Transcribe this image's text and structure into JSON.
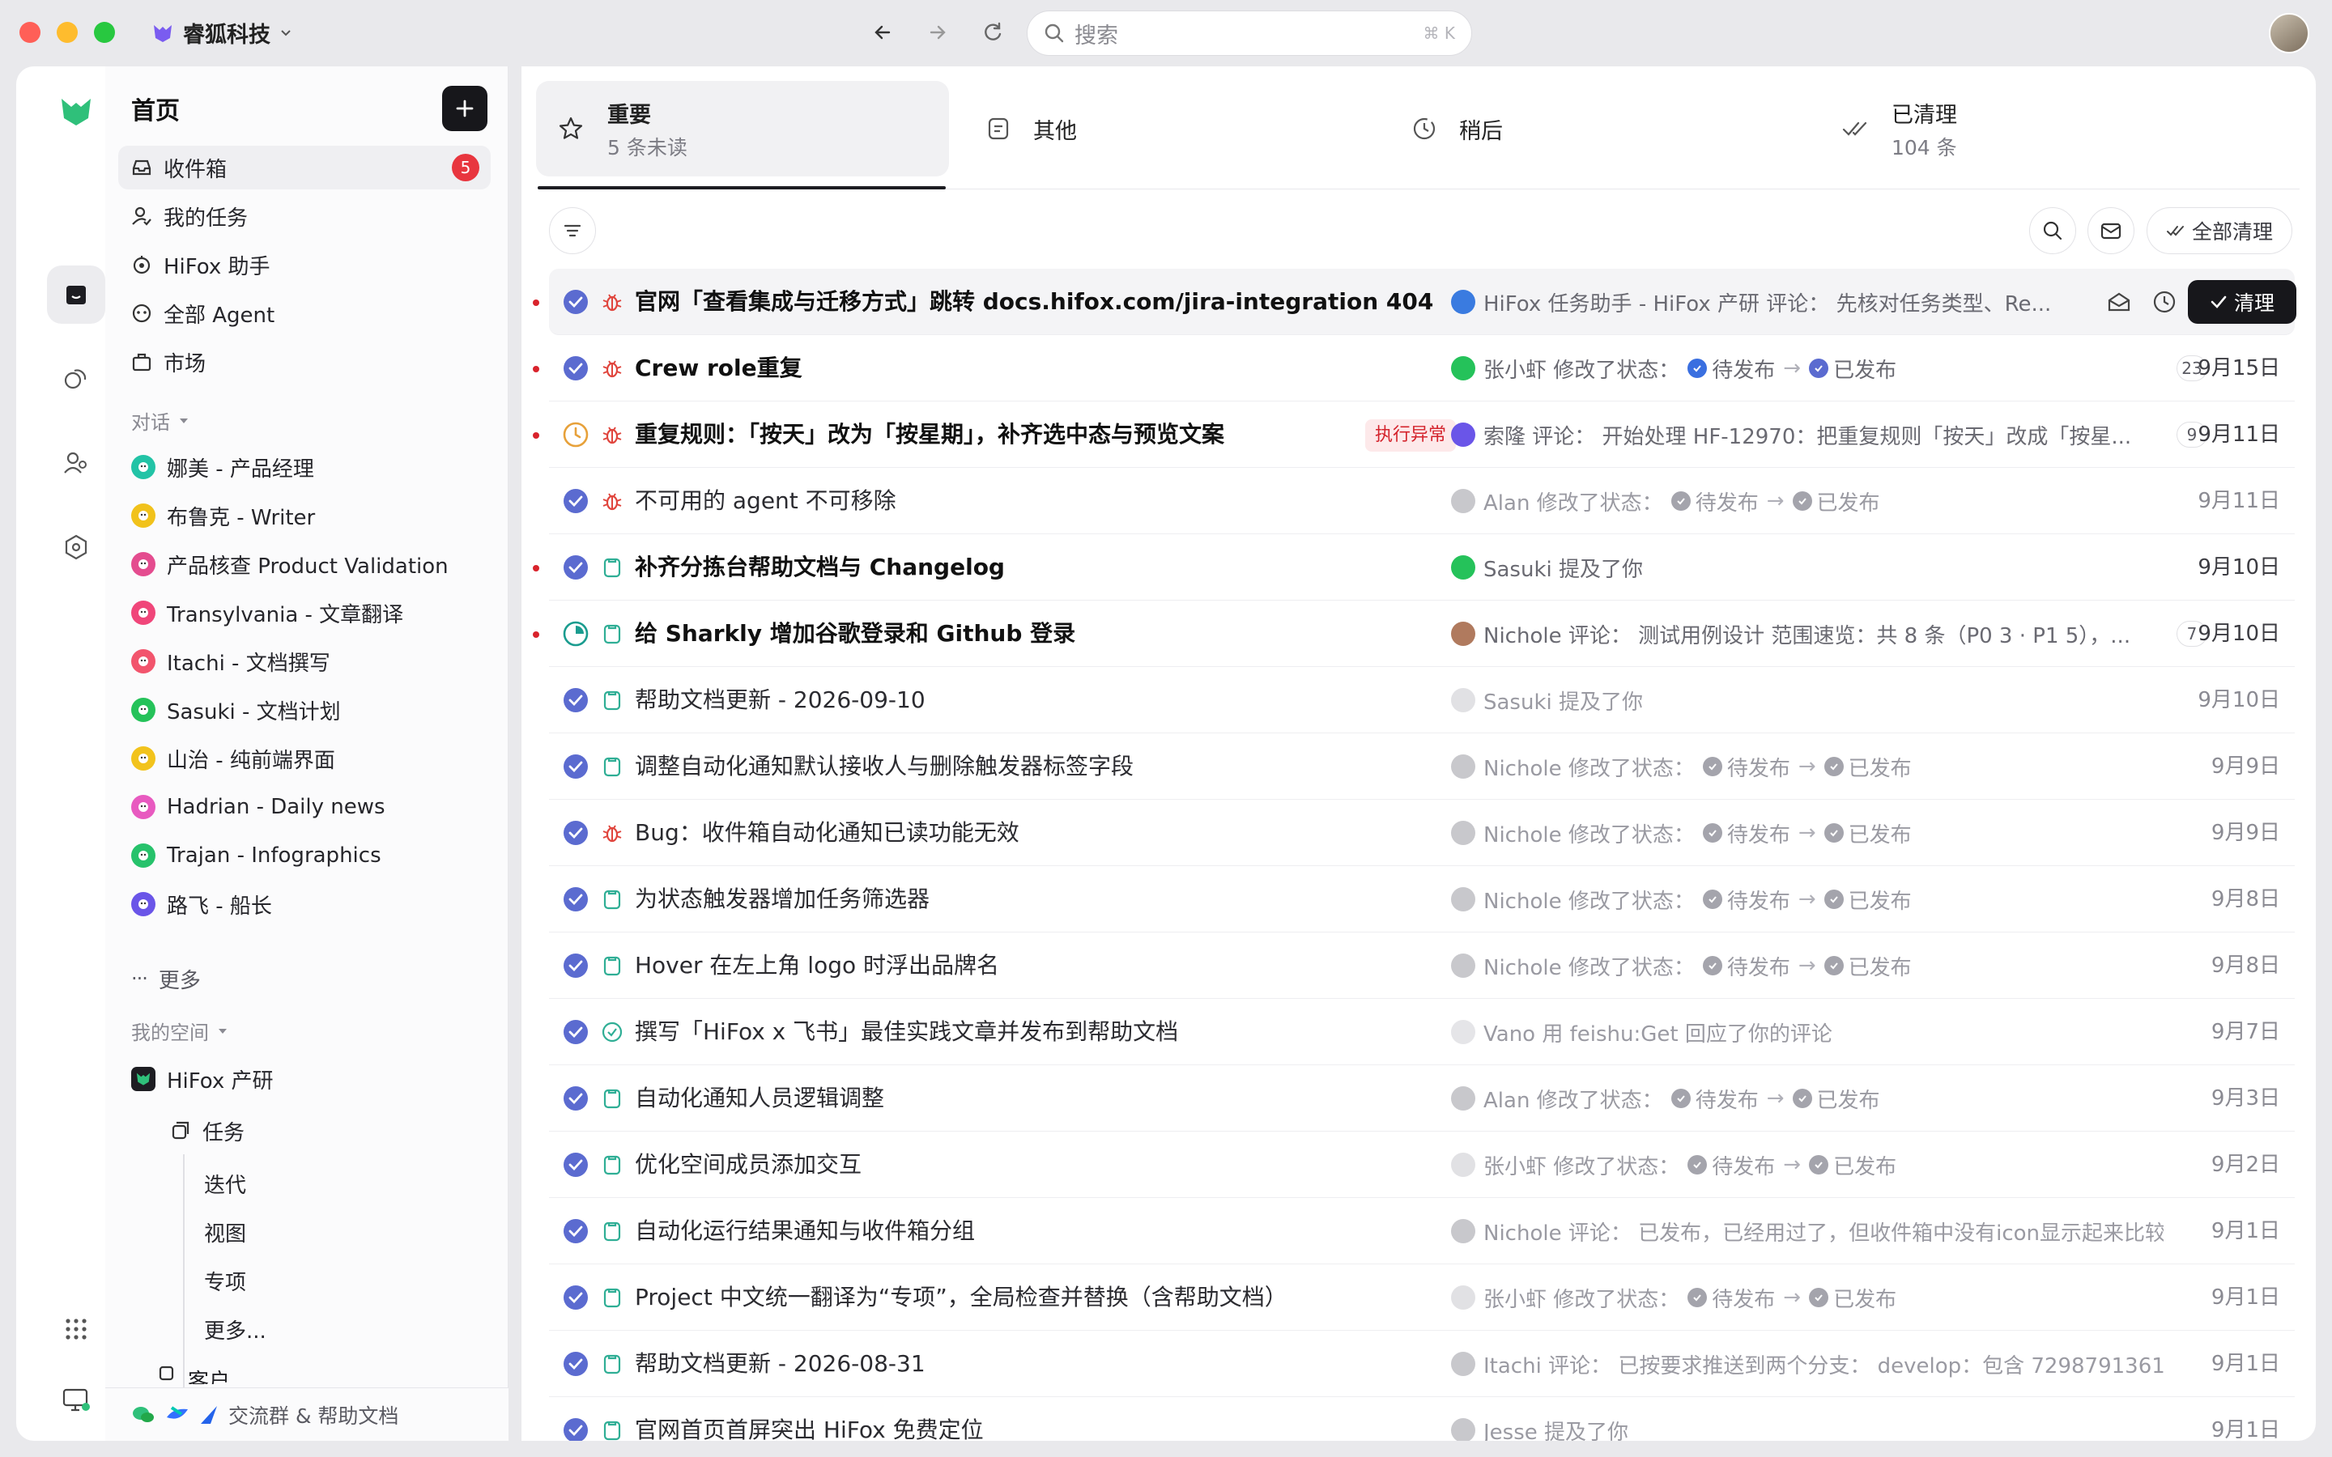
{
  "titlebar": {
    "workspace_name": "睿狐科技",
    "search_placeholder": "搜索",
    "search_shortcut": "⌘ K"
  },
  "sidebar": {
    "heading": "首页",
    "nav": [
      {
        "label": "收件箱",
        "badge": "5",
        "icon": "inbox-icon"
      },
      {
        "label": "我的任务",
        "icon": "user-task-icon"
      },
      {
        "label": "HiFox 助手",
        "icon": "assistant-icon"
      },
      {
        "label": "全部 Agent",
        "icon": "agent-icon"
      },
      {
        "label": "市场",
        "icon": "market-icon"
      }
    ],
    "conversations_label": "对话",
    "conversations": [
      {
        "label": "娜美 - 产品经理",
        "color": "#22c3a6"
      },
      {
        "label": "布鲁克 - Writer",
        "color": "#f1c21b"
      },
      {
        "label": "产品核查 Product Validation",
        "color": "#e44c8f"
      },
      {
        "label": "Transylvania - 文章翻译",
        "color": "#f0467a"
      },
      {
        "label": "Itachi - 文档撰写",
        "color": "#f2556d"
      },
      {
        "label": "Sasuki - 文档计划",
        "color": "#25c25a"
      },
      {
        "label": "山治 - 纯前端界面",
        "color": "#f2c31c"
      },
      {
        "label": "Hadrian - Daily news",
        "color": "#e85ac0"
      },
      {
        "label": "Trajan - Infographics",
        "color": "#26c26b"
      },
      {
        "label": "路飞 - 船长",
        "color": "#6a55e8"
      }
    ],
    "more_label": "更多",
    "spaces_label": "我的空间",
    "space": {
      "name": "HiFox 产研",
      "tasks_label": "任务",
      "task_children": [
        "迭代",
        "视图",
        "专项",
        "更多..."
      ],
      "next_label": "客户"
    },
    "footer_label": "交流群 & 帮助文档"
  },
  "tabs": [
    {
      "label": "重要",
      "sub": "5 条未读",
      "icon": "star-icon"
    },
    {
      "label": "其他",
      "sub": "",
      "icon": "doc-icon"
    },
    {
      "label": "稍后",
      "sub": "",
      "icon": "clock-icon"
    },
    {
      "label": "已清理",
      "sub": "104 条",
      "icon": "double-check-icon"
    }
  ],
  "toolbar": {
    "clear_all_label": "全部清理",
    "clean_label": "清理"
  },
  "rows": [
    {
      "unread": true,
      "status": "done",
      "type": "bug",
      "title": "官网「查看集成与迁移方式」跳转 docs.hifox.com/jira-integration 404",
      "bold": true,
      "activity": "HiFox 任务助手 - HiFox 产研 评论： 先核对任务类型、Re...",
      "kind": "text",
      "avatar": "#3a7be0",
      "hover": true
    },
    {
      "unread": true,
      "status": "done",
      "type": "bug",
      "title": "Crew role重复",
      "bold": true,
      "actor": "张小虾 修改了状态：",
      "from": "待发布",
      "to": "已发布",
      "kind": "status",
      "avatar": "#25c25a",
      "count": "23",
      "date": "9月15日"
    },
    {
      "unread": true,
      "status": "progress",
      "type": "bug",
      "title": "重复规则：「按天」改为「按星期」，补齐选中态与预览文案",
      "bold": true,
      "tag": "执行异常",
      "activity": "索隆 评论： 开始处理 HF-12970：把重复规则「按天」改成「按星...",
      "kind": "text",
      "avatar": "#6a55e8",
      "count": "9",
      "date": "9月11日"
    },
    {
      "unread": false,
      "status": "done",
      "type": "bug",
      "title": "不可用的 agent 不可移除",
      "bold": false,
      "actor": "Alan 修改了状态：",
      "from": "待发布",
      "to": "已发布",
      "kind": "status",
      "avatar": "#9a9aa2",
      "date": "9月11日"
    },
    {
      "unread": true,
      "status": "done",
      "type": "task",
      "title": "补齐分拣台帮助文档与 Changelog",
      "bold": true,
      "activity": "Sasuki 提及了你",
      "kind": "text",
      "avatar": "#25c25a",
      "date": "9月10日"
    },
    {
      "unread": true,
      "status": "review",
      "type": "task",
      "title": "给 Sharkly 增加谷歌登录和 Github 登录",
      "bold": true,
      "activity": "Nichole 评论： 测试用例设计 范围速览：共 8 条（P0 3 · P1 5），...",
      "kind": "text",
      "avatar": "#b07a5e",
      "count": "7",
      "date": "9月10日"
    },
    {
      "unread": false,
      "status": "done",
      "type": "task",
      "title": "帮助文档更新 - 2026-09-10",
      "bold": false,
      "activity": "Sasuki 提及了你",
      "kind": "text",
      "avatar": "#c8c8ce",
      "date": "9月10日"
    },
    {
      "unread": false,
      "status": "done",
      "type": "task",
      "title": "调整自动化通知默认接收人与删除触发器标签字段",
      "bold": false,
      "actor": "Nichole 修改了状态：",
      "from": "待发布",
      "to": "已发布",
      "kind": "status",
      "avatar": "#9a9aa2",
      "date": "9月9日"
    },
    {
      "unread": false,
      "status": "done",
      "type": "bug",
      "title": "Bug：收件箱自动化通知已读功能无效",
      "bold": false,
      "actor": "Nichole 修改了状态：",
      "from": "待发布",
      "to": "已发布",
      "kind": "status",
      "avatar": "#9a9aa2",
      "date": "9月9日"
    },
    {
      "unread": false,
      "status": "done",
      "type": "task",
      "title": "为状态触发器增加任务筛选器",
      "bold": false,
      "actor": "Nichole 修改了状态：",
      "from": "待发布",
      "to": "已发布",
      "kind": "status",
      "avatar": "#9a9aa2",
      "date": "9月8日"
    },
    {
      "unread": false,
      "status": "done",
      "type": "task",
      "title": "Hover 在左上角 logo 时浮出品牌名",
      "bold": false,
      "actor": "Nichole 修改了状态：",
      "from": "待发布",
      "to": "已发布",
      "kind": "status",
      "avatar": "#9a9aa2",
      "date": "9月8日"
    },
    {
      "unread": false,
      "status": "done",
      "type": "milestone",
      "title": "撰写「HiFox x 飞书」最佳实践文章并发布到帮助文档",
      "bold": false,
      "activity": "Vano 用 feishu:Get 回应了你的评论",
      "kind": "text",
      "avatar": "#d0d0d6",
      "date": "9月7日"
    },
    {
      "unread": false,
      "status": "done",
      "type": "task",
      "title": "自动化通知人员逻辑调整",
      "bold": false,
      "actor": "Alan 修改了状态：",
      "from": "待发布",
      "to": "已发布",
      "kind": "status",
      "avatar": "#9a9aa2",
      "date": "9月3日"
    },
    {
      "unread": false,
      "status": "done",
      "type": "task",
      "title": "优化空间成员添加交互",
      "bold": false,
      "actor": "张小虾 修改了状态：",
      "from": "待发布",
      "to": "已发布",
      "kind": "status",
      "avatar": "#c8c8ce",
      "date": "9月2日"
    },
    {
      "unread": false,
      "status": "done",
      "type": "task",
      "title": "自动化运行结果通知与收件箱分组",
      "bold": false,
      "activity": "Nichole 评论： 已发布，已经用过了，但收件箱中没有icon显示起来比较...",
      "kind": "text",
      "avatar": "#9a9aa2",
      "date": "9月1日"
    },
    {
      "unread": false,
      "status": "done",
      "type": "task",
      "title": "Project 中文统一翻译为“专项”，全局检查并替换（含帮助文档）",
      "bold": false,
      "actor": "张小虾 修改了状态：",
      "from": "待发布",
      "to": "已发布",
      "kind": "status",
      "avatar": "#c8c8ce",
      "date": "9月1日"
    },
    {
      "unread": false,
      "status": "done",
      "type": "task",
      "title": "帮助文档更新 - 2026-08-31",
      "bold": false,
      "activity": "Itachi 评论： 已按要求推送到两个分支： develop：包含 7298791361 d...",
      "kind": "text",
      "avatar": "#9a9aa2",
      "date": "9月1日"
    },
    {
      "unread": false,
      "status": "done",
      "type": "task",
      "title": "官网首页首屏突出 HiFox 免费定位",
      "bold": false,
      "activity": "Jesse 提及了你",
      "kind": "text",
      "avatar": "#9a9aa2",
      "date": "9月1日"
    }
  ],
  "colors": {
    "accent": "#5b6bd0",
    "unread": "#d9232c",
    "bug": "#e0453d",
    "task": "#2fae95",
    "brand": "#2fc07a"
  }
}
